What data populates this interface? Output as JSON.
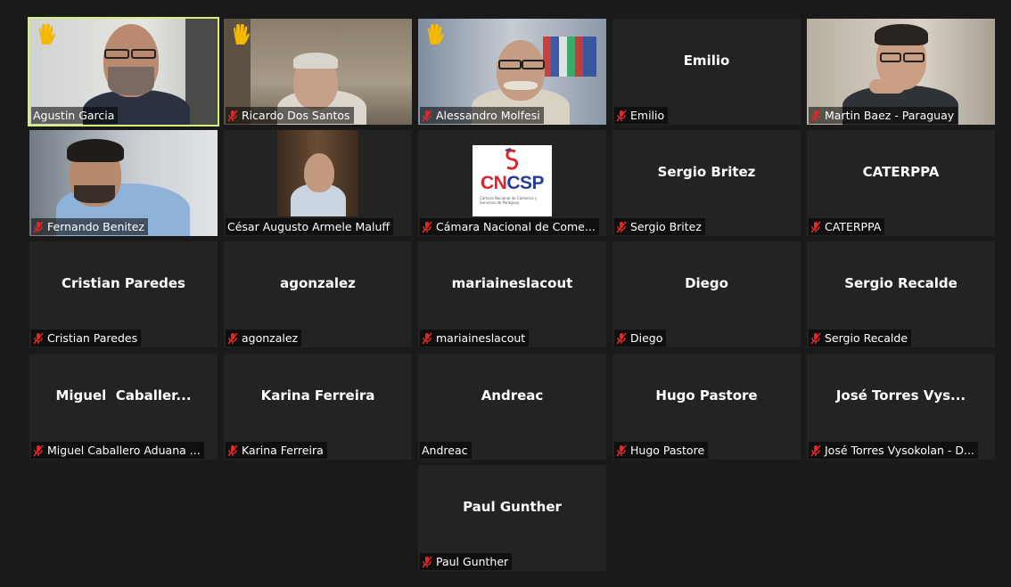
{
  "participants": [
    {
      "name": "Agustin Garcia",
      "muted": false,
      "video": true,
      "hand_raised": true,
      "active_speaker": true
    },
    {
      "name": "Ricardo Dos Santos",
      "muted": true,
      "video": true,
      "hand_raised": true
    },
    {
      "name": "Alessandro Molfesi",
      "muted": true,
      "video": true,
      "hand_raised": true
    },
    {
      "name": "Emilio",
      "display": "Emilio",
      "muted": true,
      "video": false
    },
    {
      "name": "Martin Baez - Paraguay",
      "muted": true,
      "video": true
    },
    {
      "name": "Fernando Benitez",
      "muted": true,
      "video": true
    },
    {
      "name": "César Augusto Armele Maluff",
      "muted": false,
      "video": true
    },
    {
      "name": "Cámara Nacional de Come...",
      "muted": true,
      "video": true,
      "logo": {
        "text": "CNCSP",
        "subtext": "Cámara Nacional de Comercio y Servicios de Paraguay"
      }
    },
    {
      "name": "Sergio Britez",
      "display": "Sergio Britez",
      "muted": true,
      "video": false
    },
    {
      "name": "CATERPPA",
      "display": "CATERPPA",
      "muted": true,
      "video": false
    },
    {
      "name": "Cristian Paredes",
      "display": "Cristian Paredes",
      "muted": true,
      "video": false
    },
    {
      "name": "agonzalez",
      "display": "agonzalez",
      "muted": true,
      "video": false
    },
    {
      "name": "mariaineslacout",
      "display": "mariaineslacout",
      "muted": true,
      "video": false
    },
    {
      "name": "Diego",
      "display": "Diego",
      "muted": true,
      "video": false
    },
    {
      "name": "Sergio Recalde",
      "display": "Sergio Recalde",
      "muted": true,
      "video": false
    },
    {
      "name": "Miguel Caballero Aduana ...",
      "display": "Miguel  Caballer...",
      "muted": true,
      "video": false
    },
    {
      "name": "Karina Ferreira",
      "display": "Karina Ferreira",
      "muted": true,
      "video": false
    },
    {
      "name": "Andreac",
      "display": "Andreac",
      "muted": false,
      "video": false
    },
    {
      "name": "Hugo Pastore",
      "display": "Hugo Pastore",
      "muted": true,
      "video": false
    },
    {
      "name": "José Torres Vysokolan - D...",
      "display": "José Torres Vys...",
      "muted": true,
      "video": false
    },
    {
      "name": "Paul Gunther",
      "display": "Paul Gunther",
      "muted": true,
      "video": false
    }
  ],
  "colors": {
    "background": "#1a1a1a",
    "tile": "#232323",
    "active_speaker_border": "#d7f07a",
    "muted_icon": "#e02828",
    "hand_icon": "#f5b800"
  },
  "icons": {
    "mute": "muted-mic-icon",
    "hand": "raised-hand-icon"
  }
}
